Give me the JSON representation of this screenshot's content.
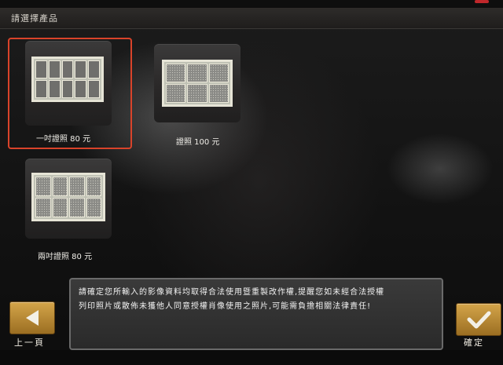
{
  "header": {
    "title": "請選擇產品"
  },
  "products": [
    {
      "label": "一吋證照 80 元",
      "selected": true,
      "grid": "2x5"
    },
    {
      "label": "證照 100 元",
      "selected": false,
      "grid": "2x3"
    },
    {
      "label": "兩吋證照 80 元",
      "selected": false,
      "grid": "2x4"
    }
  ],
  "notice": {
    "line1": "請確定您所輸入的影像資料均取得合法使用暨重製改作權,提醒您如未經合法授權",
    "line2": "列印照片或散佈未獲他人同意授權肖像使用之照片,可能需負擔相關法律責任!"
  },
  "nav": {
    "back_label": "上一頁",
    "confirm_label": "確定"
  },
  "colors": {
    "accent": "#d9432a",
    "button": "#c2923c"
  },
  "icons": {
    "back": "arrow-left-icon",
    "confirm": "checkmark-icon"
  }
}
